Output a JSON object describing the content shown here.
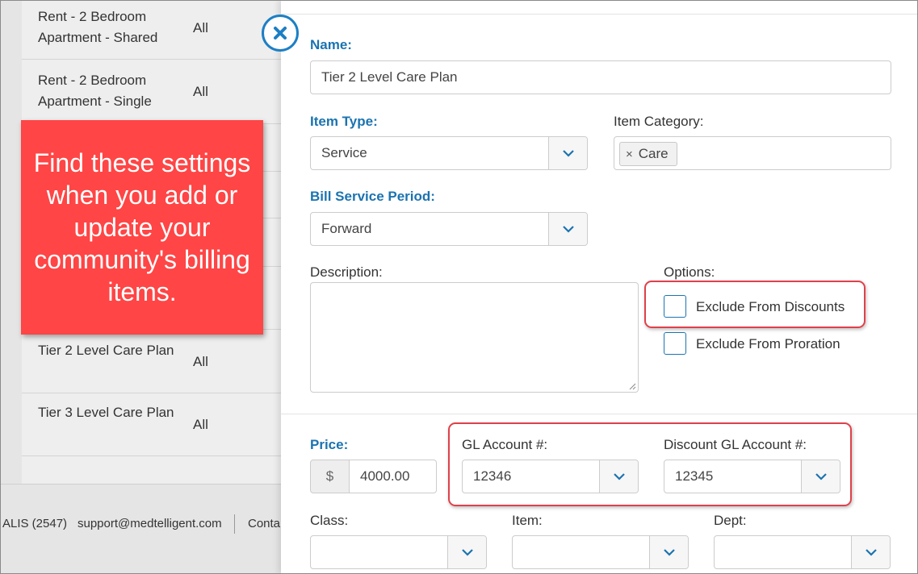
{
  "list": {
    "rows": [
      {
        "name": "Rent - 2 Bedroom Apartment - Shared",
        "scope": "All"
      },
      {
        "name": "Rent - 2 Bedroom Apartment - Single",
        "scope": "All"
      },
      {
        "name": "Tier 2 Level Care Plan",
        "scope": "All"
      },
      {
        "name": "Tier 3 Level Care Plan",
        "scope": "All"
      }
    ]
  },
  "footer": {
    "phone": "ALIS (2547)",
    "email": "support@medtelligent.com",
    "contact": "Conta"
  },
  "callout": {
    "text": "Find these settings when you add or update your community's billing items."
  },
  "form": {
    "name_label": "Name:",
    "name_value": "Tier 2 Level Care Plan",
    "item_type_label": "Item Type:",
    "item_type_value": "Service",
    "item_category_label": "Item Category:",
    "item_category_tag": "Care",
    "tag_remove": "×",
    "bill_period_label": "Bill Service Period:",
    "bill_period_value": "Forward",
    "description_label": "Description:",
    "description_value": "",
    "options_label": "Options:",
    "exclude_discounts_label": "Exclude From Discounts",
    "exclude_discounts_checked": false,
    "exclude_proration_label": "Exclude From Proration",
    "exclude_proration_checked": false,
    "price_label": "Price:",
    "currency_symbol": "$",
    "price_value": "4000.00",
    "gl_account_label": "GL Account #:",
    "gl_account_value": "12346",
    "discount_gl_label": "Discount GL Account #:",
    "discount_gl_value": "12345",
    "class_label": "Class:",
    "class_value": "",
    "item_label": "Item:",
    "item_value": "",
    "dept_label": "Dept:",
    "dept_value": ""
  },
  "colors": {
    "accent": "#1b73b0",
    "callout": "#ff4545",
    "highlight": "#e0404a"
  },
  "icons": {
    "close": "close-circle-icon",
    "dropdown": "chevron-down-icon"
  }
}
